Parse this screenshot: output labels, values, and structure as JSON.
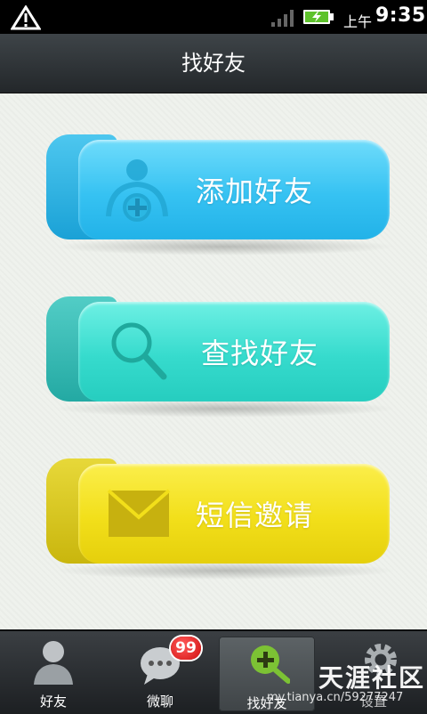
{
  "status_bar": {
    "ampm": "上午",
    "time": "9:35",
    "icons": [
      "warning-icon",
      "signal-icon",
      "battery-charging-icon"
    ]
  },
  "header": {
    "title": "找好友"
  },
  "actions": [
    {
      "label": "添加好友",
      "icon": "add-user-icon",
      "color": "#36c2f2"
    },
    {
      "label": "查找好友",
      "icon": "search-icon",
      "color": "#36dbcd"
    },
    {
      "label": "短信邀请",
      "icon": "envelope-icon",
      "color": "#f2df1a"
    }
  ],
  "tabs": [
    {
      "label": "好友",
      "icon": "person-icon",
      "active": false
    },
    {
      "label": "微聊",
      "icon": "chat-bubble-icon",
      "badge": "99",
      "active": false
    },
    {
      "label": "找好友",
      "icon": "find-friend-icon",
      "active": true
    },
    {
      "label": "设置",
      "icon": "gear-icon",
      "active": false
    }
  ],
  "watermark": {
    "logo": "天涯社区",
    "url": "my.tianya.cn/59277247"
  }
}
